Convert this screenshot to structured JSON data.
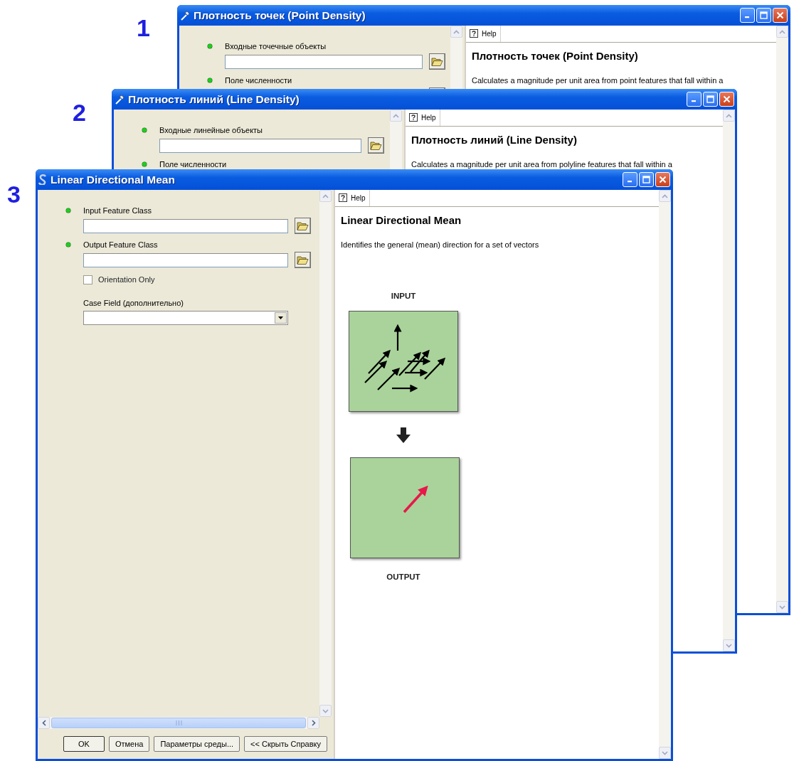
{
  "windows": [
    {
      "number": "1",
      "kind": "tool",
      "title": "Плотность точек (Point Density)",
      "parameters": [
        {
          "kind": "input",
          "label": "Входные точечные объекты",
          "required": true
        },
        {
          "kind": "input",
          "label": "Поле численности",
          "required": true
        }
      ],
      "help": {
        "tab": "Help",
        "heading": "Плотность точек (Point Density)",
        "description": "Calculates a magnitude per unit area from point features that fall within a"
      }
    },
    {
      "number": "2",
      "kind": "tool",
      "title": "Плотность линий (Line Density)",
      "parameters": [
        {
          "kind": "input",
          "label": "Входные линейные объекты",
          "required": true
        },
        {
          "kind": "input",
          "label": "Поле численности",
          "required": true
        }
      ],
      "help": {
        "tab": "Help",
        "heading": "Плотность линий (Line Density)",
        "description": "Calculates a magnitude per unit area from polyline features that fall within a"
      }
    },
    {
      "number": "3",
      "kind": "script",
      "title": "Linear Directional Mean",
      "parameters": [
        {
          "kind": "input",
          "label": "Input Feature Class",
          "required": true
        },
        {
          "kind": "output",
          "label": "Output Feature Class",
          "required": true
        },
        {
          "kind": "checkbox",
          "label": "Orientation Only",
          "checked": false
        },
        {
          "kind": "dropdown",
          "label": "Case Field (дополнительно)"
        }
      ],
      "help": {
        "tab": "Help",
        "heading": "Linear Directional Mean",
        "description": "Identifies the general (mean) direction for a set of vectors",
        "diagram": {
          "input_label": "INPUT",
          "output_label": "OUTPUT"
        }
      },
      "buttons": [
        "OK",
        "Отмена",
        "Параметры среды...",
        "<< Скрыть Справку"
      ]
    }
  ]
}
